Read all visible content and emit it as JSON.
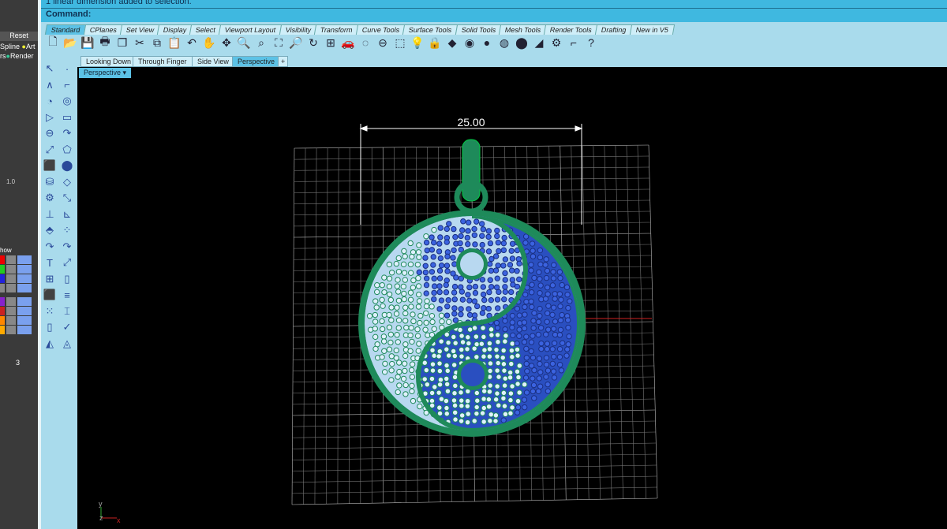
{
  "command": {
    "history": "1 linear dimension added to selection.",
    "prompt": "Command:"
  },
  "toolbar_tabs": [
    "Standard",
    "CPlanes",
    "Set View",
    "Display",
    "Select",
    "Viewport Layout",
    "Visibility",
    "Transform",
    "Curve Tools",
    "Surface Tools",
    "Solid Tools",
    "Mesh Tools",
    "Render Tools",
    "Drafting",
    "New in V5"
  ],
  "viewport_tabs": [
    "Looking Down",
    "Through Finger",
    "Side View",
    "Perspective"
  ],
  "viewport": {
    "label": "Perspective",
    "dimension": "25.00",
    "axis_x": "x",
    "axis_y": "y",
    "axis_z": "z"
  },
  "left_panel": {
    "reset": "Reset",
    "spline": "Spline",
    "art": "Art",
    "rs": "rs",
    "render": "Render",
    "show": "how",
    "layer_count": "3",
    "zoom_value": "1.0"
  },
  "colors": {
    "accent": "#3fb8e0",
    "pendant_green": "#1e8a5a",
    "blue_gems": "#2a4fc0",
    "light_gems": "#b8d8f0"
  }
}
